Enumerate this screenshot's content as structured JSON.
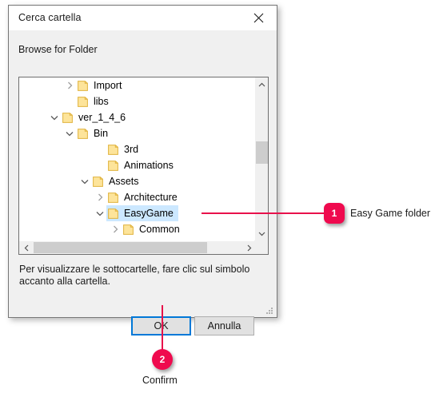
{
  "dialog": {
    "title": "Cerca cartella",
    "close_icon": "close-icon",
    "browse_label": "Browse for Folder",
    "hint": "Per visualizzare le sottocartelle, fare clic sul simbolo accanto alla cartella.",
    "ok_label": "OK",
    "cancel_label": "Annulla"
  },
  "tree": {
    "items": [
      {
        "label": "Import",
        "depth": 2,
        "twisty": "collapsed",
        "selected": false
      },
      {
        "label": "libs",
        "depth": 2,
        "twisty": "none",
        "selected": false
      },
      {
        "label": "ver_1_4_6",
        "depth": 1,
        "twisty": "expanded",
        "selected": false
      },
      {
        "label": "Bin",
        "depth": 2,
        "twisty": "expanded",
        "selected": false
      },
      {
        "label": "3rd",
        "depth": 4,
        "twisty": "none",
        "selected": false
      },
      {
        "label": "Animations",
        "depth": 4,
        "twisty": "none",
        "selected": false
      },
      {
        "label": "Assets",
        "depth": 3,
        "twisty": "expanded",
        "selected": false
      },
      {
        "label": "Architecture",
        "depth": 4,
        "twisty": "collapsed",
        "selected": false
      },
      {
        "label": "EasyGame",
        "depth": 4,
        "twisty": "expanded",
        "selected": true
      },
      {
        "label": "Common",
        "depth": 5,
        "twisty": "collapsed",
        "selected": false
      }
    ],
    "scrollbars": {
      "vertical_up_icon": "chevron-up-icon",
      "vertical_down_icon": "chevron-down-icon",
      "horizontal_left_icon": "chevron-left-icon",
      "horizontal_right_icon": "chevron-right-icon"
    }
  },
  "annotations": [
    {
      "number": "1",
      "text": "Easy Game folder"
    },
    {
      "number": "2",
      "text": "Confirm"
    }
  ],
  "colors": {
    "accent": "#ef0a4e",
    "selection": "#cce8ff",
    "focus_border": "#0078d7",
    "folder_fill": "#fde49a",
    "folder_stroke": "#e0b23c",
    "dialog_bg": "#f0f0f0"
  }
}
